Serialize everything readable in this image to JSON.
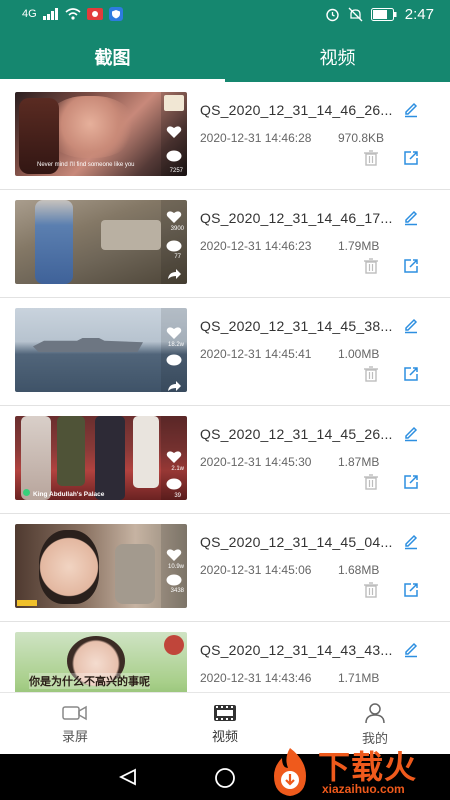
{
  "status_bar": {
    "network": "4G",
    "time": "2:47"
  },
  "tabs": [
    {
      "label": "截图",
      "active": true
    },
    {
      "label": "视频",
      "active": false
    }
  ],
  "items": [
    {
      "name": "QS_2020_12_31_14_46_26...",
      "date": "2020-12-31 14:46:28",
      "size": "970.8KB",
      "thumb_caption": "Never mind I'll find someone like you",
      "stat1": "",
      "stat2": "7257"
    },
    {
      "name": "QS_2020_12_31_14_46_17...",
      "date": "2020-12-31 14:46:23",
      "size": "1.79MB",
      "thumb_caption": "",
      "stat1": "3900",
      "stat2": "77"
    },
    {
      "name": "QS_2020_12_31_14_45_38...",
      "date": "2020-12-31 14:45:41",
      "size": "1.00MB",
      "thumb_caption": "",
      "stat1": "18.2w",
      "stat2": "",
      "stat3": ""
    },
    {
      "name": "QS_2020_12_31_14_45_26...",
      "date": "2020-12-31 14:45:30",
      "size": "1.87MB",
      "thumb_caption": "King Abdullah's Palace",
      "stat1": "2.1w",
      "stat2": "39"
    },
    {
      "name": "QS_2020_12_31_14_45_04...",
      "date": "2020-12-31 14:45:06",
      "size": "1.68MB",
      "thumb_caption": "",
      "stat1": "10.9w",
      "stat2": "3438"
    },
    {
      "name": "QS_2020_12_31_14_43_43...",
      "date": "2020-12-31 14:43:46",
      "size": "1.71MB",
      "thumb_caption": "你是为什么不高兴的事呢"
    }
  ],
  "bottom_nav": [
    {
      "label": "录屏",
      "icon": "camera-icon"
    },
    {
      "label": "视频",
      "icon": "film-icon",
      "active": true
    },
    {
      "label": "我的",
      "icon": "person-icon"
    }
  ],
  "watermark": {
    "text_cn": "下载火",
    "text_en": "xiazaihuo.com"
  },
  "colors": {
    "primary": "#15876f",
    "icon_blue": "#2d8fe0"
  }
}
